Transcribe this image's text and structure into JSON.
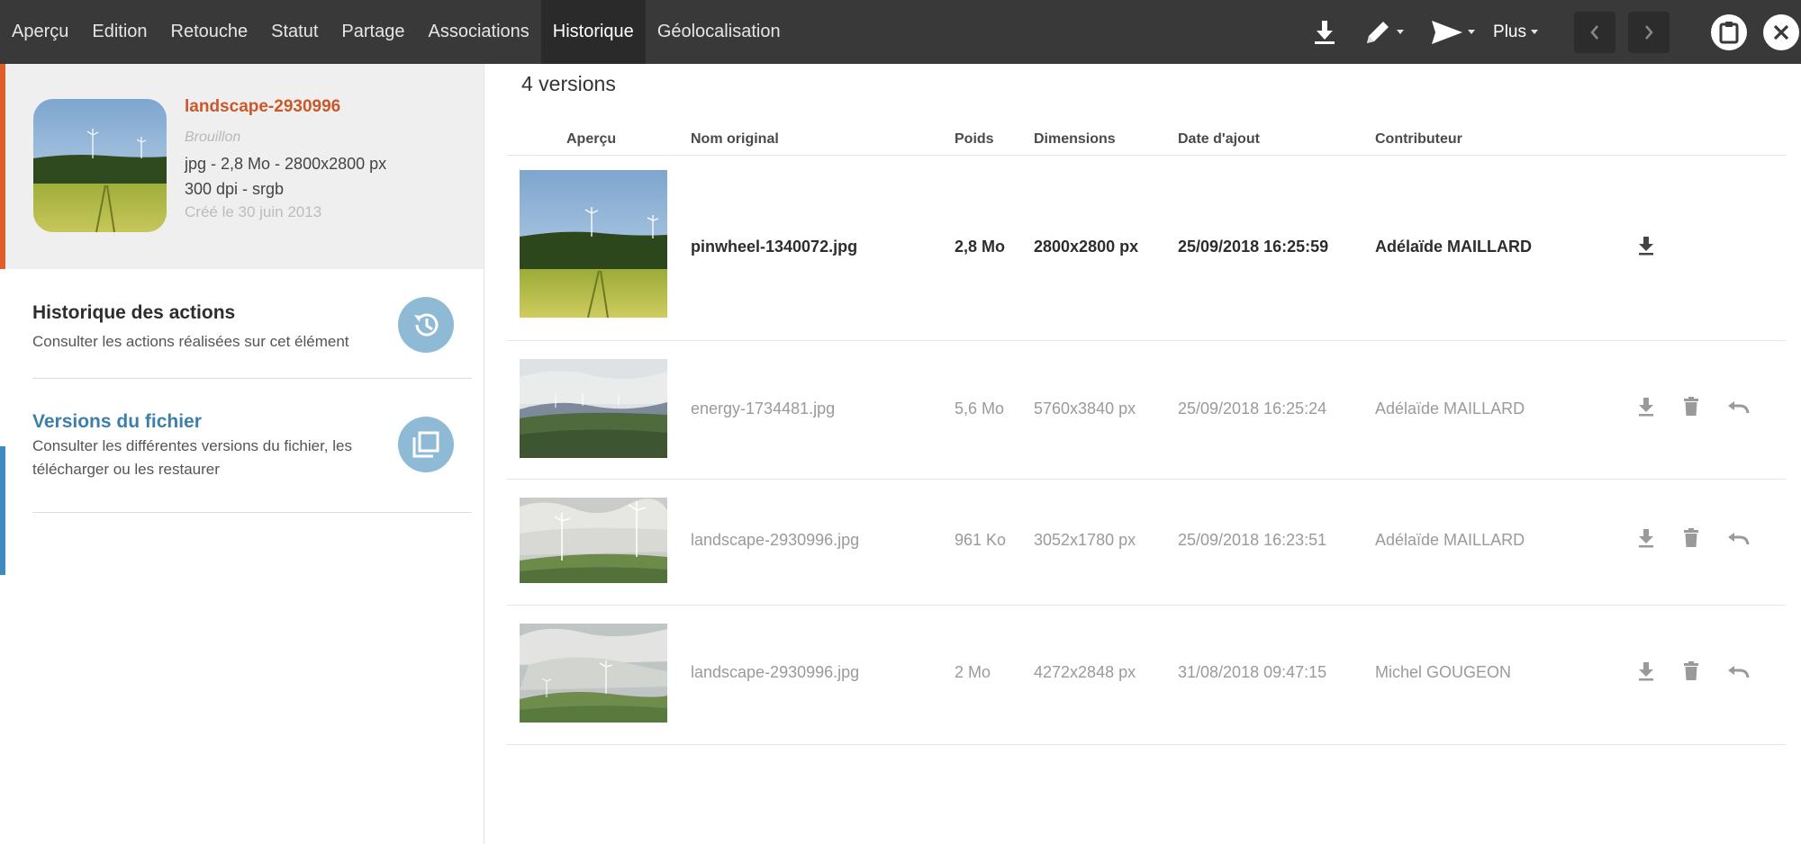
{
  "toolbar": {
    "tabs": [
      "Aperçu",
      "Edition",
      "Retouche",
      "Statut",
      "Partage",
      "Associations",
      "Historique",
      "Géolocalisation"
    ],
    "active_tab": "Historique",
    "plus_label": "Plus",
    "icons": [
      "download-icon",
      "pencil-icon",
      "send-icon",
      "chevron-left-icon",
      "chevron-right-icon",
      "clipboard-icon",
      "close-icon"
    ]
  },
  "file": {
    "name": "landscape-2930996",
    "status": "Brouillon",
    "meta_line1": "jpg - 2,8 Mo - 2800x2800 px",
    "meta_line2": "300 dpi - srgb",
    "created": "Créé le 30 juin 2013"
  },
  "sidebar": {
    "history": {
      "title": "Historique des actions",
      "description": "Consulter les actions réalisées sur cet élément"
    },
    "versions": {
      "title": "Versions du fichier",
      "description_line1": "Consulter les différentes versions du fichier, les",
      "description_line2": "télécharger ou les restaurer"
    }
  },
  "main": {
    "count_label": "4 versions",
    "columns": {
      "preview": "Aperçu",
      "name": "Nom original",
      "size": "Poids",
      "dimensions": "Dimensions",
      "date": "Date d'ajout",
      "contributor": "Contributeur"
    },
    "versions": [
      {
        "name": "pinwheel-1340072.jpg",
        "size": "2,8 Mo",
        "dimensions": "2800x2800 px",
        "date": "25/09/2018 16:25:59",
        "contributor": "Adélaïde MAILLARD",
        "current": true
      },
      {
        "name": "energy-1734481.jpg",
        "size": "5,6 Mo",
        "dimensions": "5760x3840 px",
        "date": "25/09/2018 16:25:24",
        "contributor": "Adélaïde MAILLARD",
        "current": false
      },
      {
        "name": "landscape-2930996.jpg",
        "size": "961 Ko",
        "dimensions": "3052x1780 px",
        "date": "25/09/2018 16:23:51",
        "contributor": "Adélaïde MAILLARD",
        "current": false
      },
      {
        "name": "landscape-2930996.jpg",
        "size": "2 Mo",
        "dimensions": "4272x2848 px",
        "date": "31/08/2018 09:47:15",
        "contributor": "Michel GOUGEON",
        "current": false
      }
    ]
  },
  "colors": {
    "topbar": "#393939",
    "accent_orange": "#e05c2a",
    "accent_blue": "#3d8cbf",
    "circle_blue": "#8fbad6"
  }
}
